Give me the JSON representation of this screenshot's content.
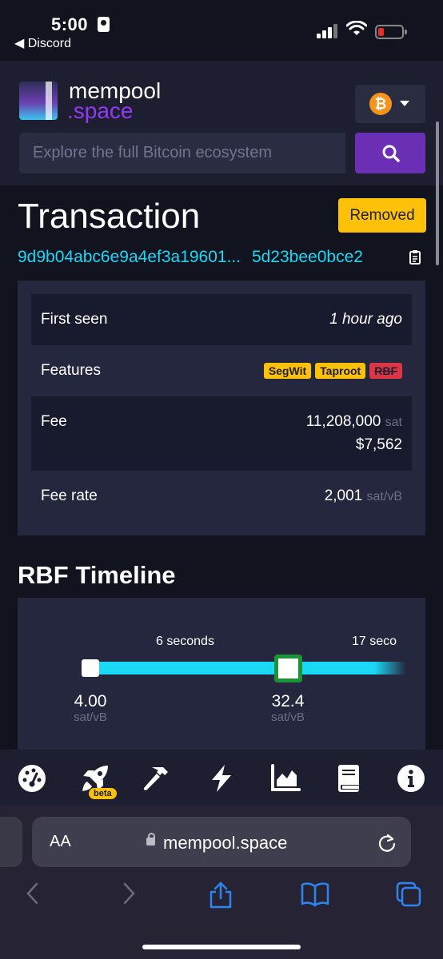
{
  "status_bar": {
    "time": "5:00",
    "back_app": "◀ Discord"
  },
  "header": {
    "logo_line1": "mempool",
    "logo_line2": ".space",
    "network_icon": "bitcoin-icon",
    "search": {
      "placeholder": "Explore the full Bitcoin ecosystem"
    }
  },
  "transaction": {
    "title": "Transaction",
    "status_badge": "Removed",
    "txid_start": "9d9b04abc6e9a4ef3a19601...",
    "txid_end": "5d23bee0bce2",
    "details": {
      "first_seen_label": "First seen",
      "first_seen_value": "1 hour ago",
      "features_label": "Features",
      "features": [
        "SegWit",
        "Taproot",
        "RBF"
      ],
      "fee_label": "Fee",
      "fee_value": "11,208,000",
      "fee_unit": "sat",
      "fee_fiat": "$7,562",
      "fee_rate_label": "Fee rate",
      "fee_rate_value": "2,001",
      "fee_rate_unit": "sat/vB"
    }
  },
  "rbf": {
    "title": "RBF Timeline",
    "times": [
      "6 seconds",
      "17 seco"
    ],
    "nodes": [
      {
        "rate": "4.00",
        "unit": "sat/vB"
      },
      {
        "rate": "32.4",
        "unit": "sat/vB"
      }
    ]
  },
  "bottom_nav": {
    "items": [
      "dashboard-icon",
      "rocket-icon",
      "hammer-icon",
      "lightning-icon",
      "chart-icon",
      "book-icon",
      "info-icon"
    ],
    "beta_label": "beta"
  },
  "safari": {
    "aa_label": "AA",
    "url": "mempool.space"
  },
  "colors": {
    "background": "#11131f",
    "header": "#1d1f31",
    "accent_purple": "#6b2fb5",
    "link_cyan": "#1bd8f4",
    "warning_yellow": "#ffc107",
    "fiat_green": "#3bcc49",
    "rbf_red": "#dc3545"
  }
}
